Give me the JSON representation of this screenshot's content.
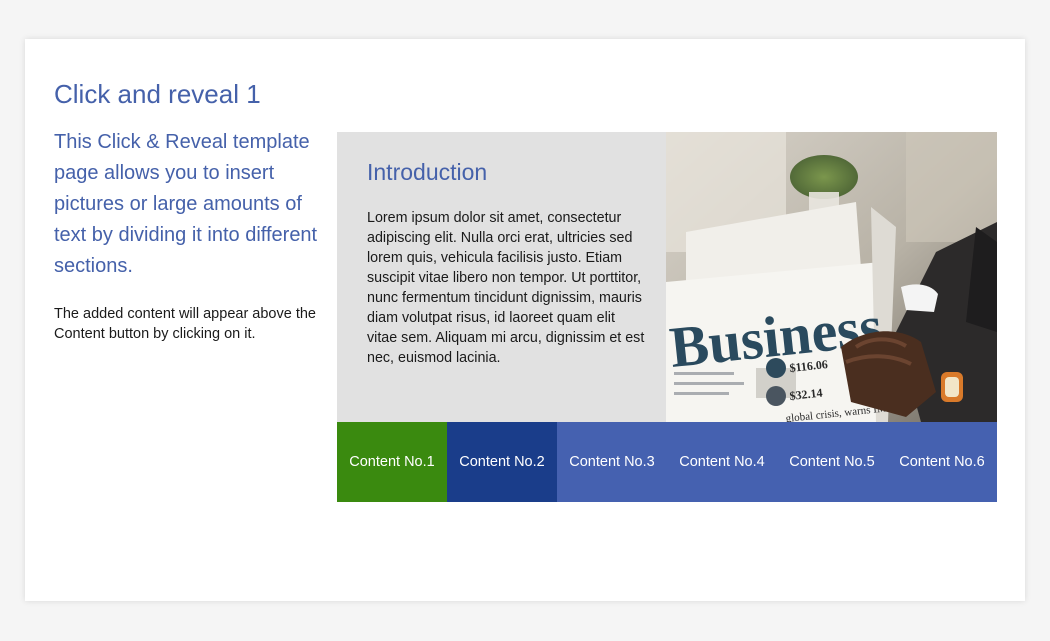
{
  "page": {
    "title": "Click and reveal 1",
    "lead": "This Click & Reveal template page allows you to insert pictures or large amounts of text by dividing it into different sections.",
    "note": "The added content will appear above the Content button by clicking on it."
  },
  "content": {
    "heading": "Introduction",
    "body": "Lorem ipsum dolor sit amet, consectetur adipiscing elit. Nulla orci erat, ultricies sed lorem quis, vehicula facilisis justo. Etiam suscipit vitae libero non tempor. Ut porttitor, nunc fermentum tincidunt dignissim, mauris diam volutpat risus, id laoreet quam elit vitae sem. Aliquam mi arcu, dignissim et est nec, euismod lacinia."
  },
  "image": {
    "subject": "newspaper-business-photo",
    "headline": "Business",
    "price_1": "$116.06",
    "price_2": "$32.14",
    "caption": "global crisis, warns IMF"
  },
  "tabs": [
    {
      "label": "Content No.1",
      "color": "#3a8a0f",
      "state": "visited"
    },
    {
      "label": "Content No.2",
      "color": "#1a3d8a",
      "state": "active"
    },
    {
      "label": "Content No.3",
      "color": "#4561b0",
      "state": "default"
    },
    {
      "label": "Content No.4",
      "color": "#4561b0",
      "state": "default"
    },
    {
      "label": "Content No.5",
      "color": "#4561b0",
      "state": "default"
    },
    {
      "label": "Content No.6",
      "color": "#4561b0",
      "state": "default"
    }
  ],
  "colors": {
    "accent": "#4561aa",
    "panel_bg": "#e1e1e1"
  }
}
